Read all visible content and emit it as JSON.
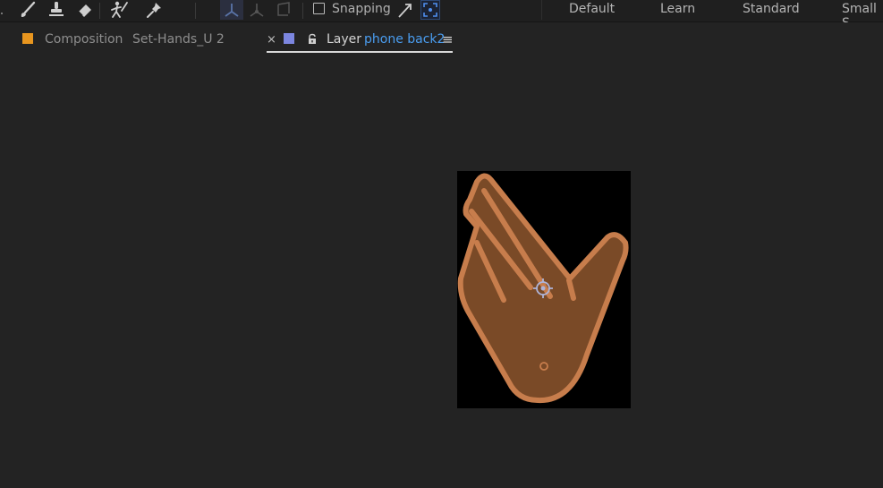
{
  "toolbar": {
    "tools": [
      "brush-tool",
      "clone-stamp-tool",
      "eraser-tool",
      "roto-brush-tool",
      "puppet-pin-tool",
      "3d-axis-local",
      "3d-axis-world",
      "3d-axis-view"
    ],
    "snapping_label": "Snapping",
    "snapping_checked": false
  },
  "workspaces": {
    "default": "Default",
    "learn": "Learn",
    "standard": "Standard",
    "small_screen": "Small S"
  },
  "tabs": {
    "composition": {
      "prefix": "Composition",
      "name": "Set-Hands_U 2",
      "color": "#e8961f"
    },
    "layer": {
      "close": "×",
      "label": "Layer",
      "name": "phone back2",
      "menu": "≡",
      "color": "#7c86e0",
      "name_color": "#4a9df0"
    }
  },
  "viewer": {
    "layer_background": "#000000",
    "hand_fill": "#7a4a27",
    "hand_stroke": "#c77d4c",
    "anchor_color": "#aeb4d8"
  }
}
